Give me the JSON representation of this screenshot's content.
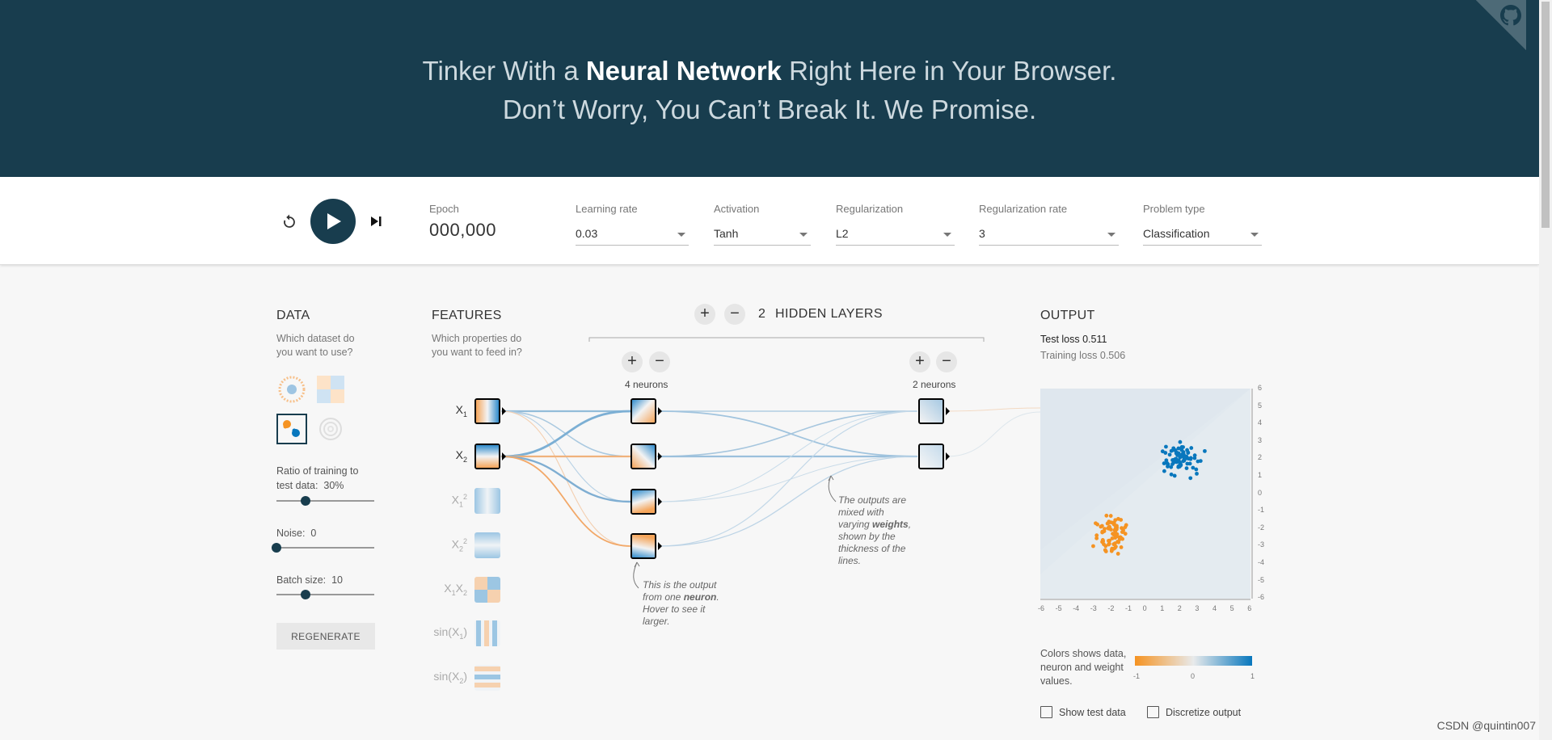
{
  "header": {
    "line1_pre": "Tinker With a ",
    "line1_bold": "Neural Network",
    "line1_post": " Right Here in Your Browser.",
    "line2": "Don’t Worry, You Can’t Break It. We Promise."
  },
  "controls": {
    "epoch_label": "Epoch",
    "epoch_value": "000,000",
    "learning_rate_label": "Learning rate",
    "learning_rate_value": "0.03",
    "activation_label": "Activation",
    "activation_value": "Tanh",
    "regularization_label": "Regularization",
    "regularization_value": "L2",
    "reg_rate_label": "Regularization rate",
    "reg_rate_value": "3",
    "problem_type_label": "Problem type",
    "problem_type_value": "Classification"
  },
  "data_panel": {
    "title": "DATA",
    "question": "Which dataset do you want to use?",
    "ratio_label": "Ratio of training to test data:",
    "ratio_value": "30%",
    "ratio_fraction": 0.3,
    "noise_label": "Noise:",
    "noise_value": "0",
    "noise_fraction": 0.0,
    "batch_label": "Batch size:",
    "batch_value": "10",
    "batch_fraction": 0.3,
    "regenerate_label": "REGENERATE"
  },
  "features_panel": {
    "title": "FEATURES",
    "question": "Which properties do you want to feed in?",
    "features": [
      {
        "base": "X",
        "sub": "1",
        "sup": "",
        "active": true
      },
      {
        "base": "X",
        "sub": "2",
        "sup": "",
        "active": true
      },
      {
        "base": "X",
        "sub": "1",
        "sup": "2",
        "active": false
      },
      {
        "base": "X",
        "sub": "2",
        "sup": "2",
        "active": false
      },
      {
        "base": "X",
        "sub": "1",
        "base2": "X",
        "sub2": "2",
        "active": false
      },
      {
        "base": "sin(X",
        "sub": "1",
        "post": ")",
        "active": false
      },
      {
        "base": "sin(X",
        "sub": "2",
        "post": ")",
        "active": false
      }
    ]
  },
  "network": {
    "hidden_layers_count": "2",
    "hidden_layers_label": "HIDDEN LAYERS",
    "plus_symbol": "+",
    "minus_symbol": "−",
    "layer1_neurons": "4 neurons",
    "layer2_neurons": "2 neurons",
    "note_neuron_pre": "This is the output from one ",
    "note_neuron_bold": "neuron",
    "note_neuron_post": ". Hover to see it larger.",
    "note_weights_pre": "The outputs are mixed with varying ",
    "note_weights_bold": "weights",
    "note_weights_post": ", shown by the thickness of the lines."
  },
  "output_panel": {
    "title": "OUTPUT",
    "test_loss": "Test loss 0.511",
    "training_loss": "Training loss 0.506",
    "y_ticks": [
      "6",
      "5",
      "4",
      "3",
      "2",
      "1",
      "0",
      "-1",
      "-2",
      "-3",
      "-4",
      "-5",
      "-6"
    ],
    "x_ticks": [
      "-6",
      "-5",
      "-4",
      "-3",
      "-2",
      "-1",
      "0",
      "1",
      "2",
      "3",
      "4",
      "5",
      "6"
    ],
    "legend_text": "Colors shows data, neuron and weight values.",
    "colorbar_ticks": [
      "-1",
      "0",
      "1"
    ],
    "show_test_data": "Show test data",
    "discretize_output": "Discretize output"
  },
  "colors": {
    "header_bg": "#183d4e",
    "orange": "#f59322",
    "blue": "#0877bd"
  },
  "watermark": "CSDN @quintin007"
}
